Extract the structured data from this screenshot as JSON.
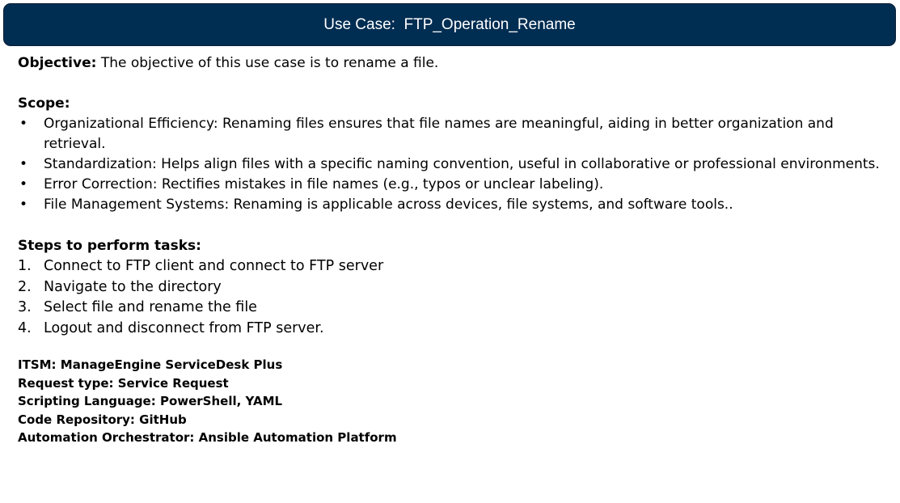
{
  "title": "Use Case:  FTP_Operation_Rename",
  "objective": {
    "label": "Objective:",
    "text": "The objective of this use case is to rename a file."
  },
  "scope": {
    "heading": "Scope:",
    "bullet_glyph": "•",
    "items": [
      "Organizational Efficiency: Renaming files ensures that file names are meaningful, aiding in better organization and retrieval.",
      "Standardization: Helps align files with a specific naming convention, useful in collaborative or professional environments.",
      "Error Correction: Rectifies mistakes in file names (e.g., typos or unclear labeling).",
      "File Management Systems: Renaming is applicable across devices, file systems, and software tools.."
    ]
  },
  "steps": {
    "heading": "Steps to perform tasks:",
    "items": [
      {
        "num": "1.",
        "text": "Connect to FTP client and connect to FTP server"
      },
      {
        "num": "2.",
        "text": "Navigate to the directory"
      },
      {
        "num": "3.",
        "text": "Select file and rename the file"
      },
      {
        "num": "4.",
        "text": "Logout and disconnect from FTP server."
      }
    ]
  },
  "meta": [
    "ITSM: ManageEngine ServiceDesk Plus",
    "Request type: Service Request",
    "Scripting Language: PowerShell, YAML",
    "Code Repository: GitHub",
    "Automation Orchestrator: Ansible Automation Platform"
  ],
  "colors": {
    "title_bar": "#002d52",
    "title_text": "#ffffff",
    "body_text": "#000000"
  }
}
